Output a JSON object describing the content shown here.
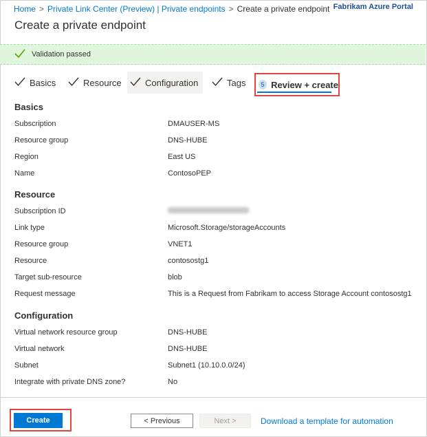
{
  "breadcrumb": {
    "home": "Home",
    "private_link_center": "Private Link Center (Preview) | Private endpoints",
    "current": "Create a private endpoint",
    "separator": ">"
  },
  "brand": "Fabrikam Azure Portal",
  "page_title": "Create a private endpoint",
  "validation": {
    "message": "Validation passed",
    "color": "#dff6dd"
  },
  "tabs": {
    "basics": "Basics",
    "resource": "Resource",
    "configuration": "Configuration",
    "tags": "Tags",
    "review_step": "5",
    "review": "Review + create"
  },
  "sections": {
    "basics": {
      "title": "Basics",
      "rows": [
        {
          "label": "Subscription",
          "value": "DMAUSER-MS"
        },
        {
          "label": "Resource group",
          "value": "DNS-HUBE"
        },
        {
          "label": "Region",
          "value": "East US"
        },
        {
          "label": "Name",
          "value": "ContosoPEP"
        }
      ]
    },
    "resource": {
      "title": "Resource",
      "rows": [
        {
          "label": "Subscription ID",
          "value": ""
        },
        {
          "label": "Link type",
          "value": "Microsoft.Storage/storageAccounts"
        },
        {
          "label": "Resource group",
          "value": "VNET1"
        },
        {
          "label": "Resource",
          "value": "contosostg1"
        },
        {
          "label": "Target sub-resource",
          "value": "blob"
        },
        {
          "label": "Request message",
          "value": "This is a Request from Fabrikam to access Storage Account contosostg1"
        }
      ]
    },
    "configuration": {
      "title": "Configuration",
      "rows": [
        {
          "label": "Virtual network resource group",
          "value": "DNS-HUBE"
        },
        {
          "label": "Virtual network",
          "value": "DNS-HUBE"
        },
        {
          "label": "Subnet",
          "value": "Subnet1 (10.10.0.0/24)"
        },
        {
          "label": "Integrate with private DNS zone?",
          "value": "No"
        }
      ]
    }
  },
  "footer": {
    "create": "Create",
    "previous": "< Previous",
    "next": "Next >",
    "template_link": "Download a template for automation"
  },
  "colors": {
    "accent": "#0078d4",
    "highlight": "#e0443c"
  }
}
